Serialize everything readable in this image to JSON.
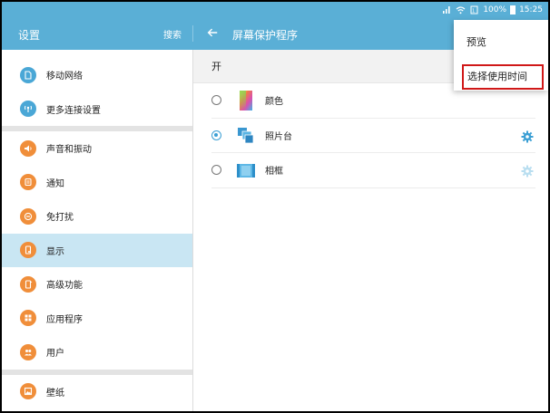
{
  "status_bar": {
    "battery_pct": "100%",
    "time": "15:25"
  },
  "header": {
    "left_title": "设置",
    "search_label": "搜索",
    "back_icon": "arrow-left-icon",
    "right_title": "屏幕保护程序"
  },
  "sidebar": {
    "groups": [
      [
        {
          "label": "移动网络",
          "icon": "sim-card-icon",
          "color": "#4aa7d6"
        },
        {
          "label": "更多连接设置",
          "icon": "antenna-icon",
          "color": "#4aa7d6"
        }
      ],
      [
        {
          "label": "声音和振动",
          "icon": "speaker-icon",
          "color": "#f08e3a"
        },
        {
          "label": "通知",
          "icon": "notification-icon",
          "color": "#f08e3a"
        },
        {
          "label": "免打扰",
          "icon": "do-not-disturb-icon",
          "color": "#f08e3a"
        },
        {
          "label": "显示",
          "icon": "display-icon",
          "color": "#f08e3a",
          "active": true
        },
        {
          "label": "高级功能",
          "icon": "advanced-features-icon",
          "color": "#f08e3a"
        },
        {
          "label": "应用程序",
          "icon": "apps-grid-icon",
          "color": "#f08e3a"
        },
        {
          "label": "用户",
          "icon": "users-icon",
          "color": "#f08e3a"
        }
      ],
      [
        {
          "label": "壁纸",
          "icon": "wallpaper-icon",
          "color": "#f08e3a"
        }
      ]
    ]
  },
  "main": {
    "toggle_label": "开",
    "options": [
      {
        "label": "颜色",
        "checked": false,
        "gear": false,
        "thumb": "colors-thumbnail"
      },
      {
        "label": "照片台",
        "checked": true,
        "gear": true,
        "gear_active": true,
        "thumb": "photo-table-thumbnail"
      },
      {
        "label": "相框",
        "checked": false,
        "gear": true,
        "gear_active": false,
        "thumb": "photo-frame-thumbnail"
      }
    ]
  },
  "popup_menu": {
    "items": [
      "预览",
      "选择使用时间"
    ]
  }
}
